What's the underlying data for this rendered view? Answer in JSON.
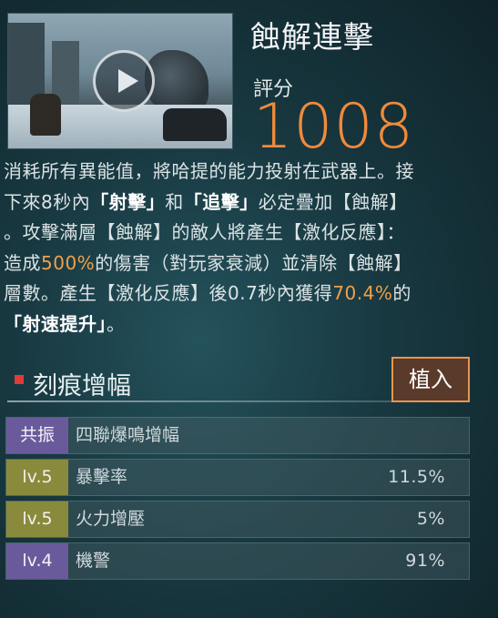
{
  "skill": {
    "title": "蝕解連擊",
    "score_label": "評分",
    "score": "1008",
    "desc": [
      {
        "t": "消耗所有異能值，將哈提的能力投射在武器上。接\n下來8秒內",
        "c": ""
      },
      {
        "t": "「射擊」",
        "c": "hl"
      },
      {
        "t": "和",
        "c": ""
      },
      {
        "t": "「追擊」",
        "c": "hl"
      },
      {
        "t": "必定疊加【蝕解】\n。攻擊滿層【蝕解】的敵人將產生【激化反應】：\n造成",
        "c": ""
      },
      {
        "t": "500%",
        "c": "num"
      },
      {
        "t": "的傷害（對玩家衰減）並清除【蝕解】\n層數。產生【激化反應】後0.7秒內獲得",
        "c": ""
      },
      {
        "t": "70.4%",
        "c": "num"
      },
      {
        "t": "的\n",
        "c": ""
      },
      {
        "t": "「射速提升」",
        "c": "hl"
      },
      {
        "t": "。",
        "c": ""
      }
    ]
  },
  "section": {
    "title": "刻痕增幅",
    "implant_label": "植入"
  },
  "rows": [
    {
      "badge": "共振",
      "name": "四聯爆鳴增幅",
      "value": "",
      "badge_color": "#6a5a9c"
    },
    {
      "badge": "lv.5",
      "name": "暴擊率",
      "value": "11.5%",
      "badge_color": "#8a8a3c"
    },
    {
      "badge": "lv.5",
      "name": "火力增壓",
      "value": "5%",
      "badge_color": "#8a8a3c"
    },
    {
      "badge": "lv.4",
      "name": "機警",
      "value": "91%",
      "badge_color": "#6a5a9c"
    }
  ]
}
